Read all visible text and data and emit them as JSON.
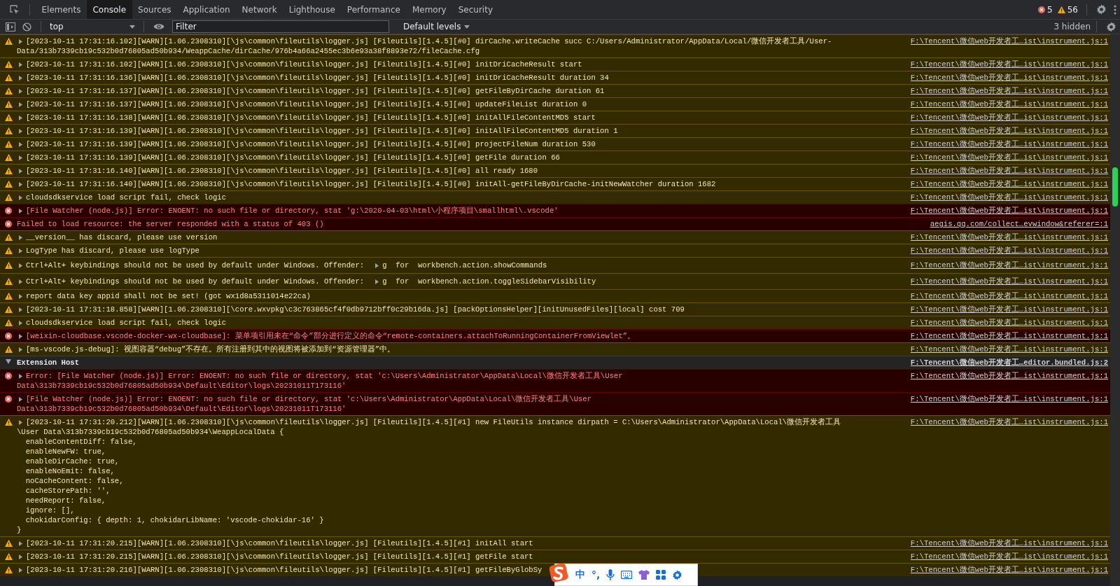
{
  "tabs": [
    {
      "label": "Elements",
      "selected": false
    },
    {
      "label": "Console",
      "selected": true
    },
    {
      "label": "Sources",
      "selected": false
    },
    {
      "label": "Application",
      "selected": false
    },
    {
      "label": "Network",
      "selected": false
    },
    {
      "label": "Lighthouse",
      "selected": false
    },
    {
      "label": "Performance",
      "selected": false
    },
    {
      "label": "Memory",
      "selected": false
    },
    {
      "label": "Security",
      "selected": false
    }
  ],
  "counts": {
    "errors": "5",
    "warnings": "56"
  },
  "console_toolbar": {
    "context": "top",
    "filter_placeholder": "Filter",
    "levels": "Default levels",
    "hidden": "3 hidden"
  },
  "messages": [
    {
      "kind": "warning",
      "expandable": true,
      "lines": [
        "[2023-10-11 17:31:16.102][WARN][1.06.2308310][\\js\\common\\fileutils\\logger.js] [Fileutils][1.4.5][#0] dirCache.writeCache succ C:/Users/Administrator/AppData/Local/微信开发者工具/User-",
        "Data/313b7339cb19c532b0d76805ad50b934/WeappCache/dirCache/976b4a66a2455ec3b6e93a38f8893e72/fileCache.cfg"
      ],
      "source": "F:\\Tencent\\微信web开发者工…ist\\instrument.js:1"
    },
    {
      "kind": "warning",
      "expandable": true,
      "lines": [
        "[2023-10-11 17:31:16.102][WARN][1.06.2308310][\\js\\common\\fileutils\\logger.js] [Fileutils][1.4.5][#0] initDriCacheResult start"
      ],
      "source": "F:\\Tencent\\微信web开发者工…ist\\instrument.js:1"
    },
    {
      "kind": "warning",
      "expandable": true,
      "lines": [
        "[2023-10-11 17:31:16.136][WARN][1.06.2308310][\\js\\common\\fileutils\\logger.js] [Fileutils][1.4.5][#0] initDriCacheResult duration 34"
      ],
      "source": "F:\\Tencent\\微信web开发者工…ist\\instrument.js:1"
    },
    {
      "kind": "warning",
      "expandable": true,
      "lines": [
        "[2023-10-11 17:31:16.137][WARN][1.06.2308310][\\js\\common\\fileutils\\logger.js] [Fileutils][1.4.5][#0] getFileByDirCache duration 61"
      ],
      "source": "F:\\Tencent\\微信web开发者工…ist\\instrument.js:1"
    },
    {
      "kind": "warning",
      "expandable": true,
      "lines": [
        "[2023-10-11 17:31:16.137][WARN][1.06.2308310][\\js\\common\\fileutils\\logger.js] [Fileutils][1.4.5][#0] updateFileList duration 0"
      ],
      "source": "F:\\Tencent\\微信web开发者工…ist\\instrument.js:1"
    },
    {
      "kind": "warning",
      "expandable": true,
      "lines": [
        "[2023-10-11 17:31:16.138][WARN][1.06.2308310][\\js\\common\\fileutils\\logger.js] [Fileutils][1.4.5][#0] initAllFileContentMD5 start"
      ],
      "source": "F:\\Tencent\\微信web开发者工…ist\\instrument.js:1"
    },
    {
      "kind": "warning",
      "expandable": true,
      "lines": [
        "[2023-10-11 17:31:16.139][WARN][1.06.2308310][\\js\\common\\fileutils\\logger.js] [Fileutils][1.4.5][#0] initAllFileContentMD5 duration 1"
      ],
      "source": "F:\\Tencent\\微信web开发者工…ist\\instrument.js:1"
    },
    {
      "kind": "warning",
      "expandable": true,
      "lines": [
        "[2023-10-11 17:31:16.139][WARN][1.06.2308310][\\js\\common\\fileutils\\logger.js] [Fileutils][1.4.5][#0] projectFileNum duration 530"
      ],
      "source": "F:\\Tencent\\微信web开发者工…ist\\instrument.js:1"
    },
    {
      "kind": "warning",
      "expandable": true,
      "lines": [
        "[2023-10-11 17:31:16.139][WARN][1.06.2308310][\\js\\common\\fileutils\\logger.js] [Fileutils][1.4.5][#0] getFile duration 66"
      ],
      "source": "F:\\Tencent\\微信web开发者工…ist\\instrument.js:1"
    },
    {
      "kind": "warning",
      "expandable": true,
      "lines": [
        "[2023-10-11 17:31:16.140][WARN][1.06.2308310][\\js\\common\\fileutils\\logger.js] [Fileutils][1.4.5][#0] all ready 1680"
      ],
      "source": "F:\\Tencent\\微信web开发者工…ist\\instrument.js:1"
    },
    {
      "kind": "warning",
      "expandable": true,
      "lines": [
        "[2023-10-11 17:31:16.140][WARN][1.06.2308310][\\js\\common\\fileutils\\logger.js] [Fileutils][1.4.5][#0] initAll-getFileByDirCache-initNewWatcher duration 1682"
      ],
      "source": "F:\\Tencent\\微信web开发者工…ist\\instrument.js:1"
    },
    {
      "kind": "warning",
      "expandable": true,
      "lines": [
        "cloudsdkservice load script fail, check logic"
      ],
      "source": "F:\\Tencent\\微信web开发者工…ist\\instrument.js:1"
    },
    {
      "kind": "error",
      "expandable": true,
      "lines": [
        "[File Watcher (node.js)] Error: ENOENT: no such file or directory, stat 'g:\\2020-04-03\\html\\小程序项目\\smallhtml\\.vscode'"
      ],
      "source": "F:\\Tencent\\微信web开发者工…ist\\instrument.js:1"
    },
    {
      "kind": "error",
      "expandable": false,
      "lines": [
        "Failed to load resource: the server responded with a status of 403 ()"
      ],
      "source": "aegis.qq.com/collect…evwindow&referer=:1"
    },
    {
      "kind": "warning",
      "expandable": true,
      "lines": [
        "__version__ has discard, please use version"
      ],
      "source": "F:\\Tencent\\微信web开发者工…ist\\instrument.js:1"
    },
    {
      "kind": "warning",
      "expandable": true,
      "lines": [
        "LogType has discard, please use logType"
      ],
      "source": "F:\\Tencent\\微信web开发者工…ist\\instrument.js:1"
    },
    {
      "kind": "warning",
      "expandable": true,
      "lines": [
        "Ctrl+Alt+ keybindings should not be used by default under Windows. Offender:"
      ],
      "offender": "g  for  workbench.action.showCommands",
      "source": "F:\\Tencent\\微信web开发者工…ist\\instrument.js:1"
    },
    {
      "kind": "warning",
      "expandable": true,
      "lines": [
        "Ctrl+Alt+ keybindings should not be used by default under Windows. Offender:"
      ],
      "offender": "g  for  workbench.action.toggleSidebarVisibility",
      "source": "F:\\Tencent\\微信web开发者工…ist\\instrument.js:1"
    },
    {
      "kind": "warning",
      "expandable": true,
      "lines": [
        "report data key appid shall not be set! (got wx1d8a5311014e22ca)"
      ],
      "source": "F:\\Tencent\\微信web开发者工…ist\\instrument.js:1"
    },
    {
      "kind": "warning",
      "expandable": true,
      "lines": [
        "[2023-10-11 17:31:18.858][WARN][1.06.2308310][\\core.wxvpkg\\c3c763865cf4f0db9712bff0c29b16da.js] [packOptionsHelper][initUnusedFiles][local] cost 709"
      ],
      "source": "F:\\Tencent\\微信web开发者工…ist\\instrument.js:1"
    },
    {
      "kind": "warning",
      "expandable": true,
      "lines": [
        "cloudsdkservice load script fail, check logic"
      ],
      "source": "F:\\Tencent\\微信web开发者工…ist\\instrument.js:1"
    },
    {
      "kind": "error",
      "expandable": true,
      "lines": [
        "[weixin-cloudbase.vscode-docker-wx-cloudbase]: 菜单项引用未在“命令”部分进行定义的命令“remote-containers.attachToRunningContainerFromViewlet”。"
      ],
      "source": "F:\\Tencent\\微信web开发者工…ist\\instrument.js:1"
    },
    {
      "kind": "warning",
      "expandable": true,
      "lines": [
        "[ms-vscode.js-debug]: 视图容器“debug”不存在。所有注册到其中的视图将被添加到“资源管理器”中。"
      ],
      "source": "F:\\Tencent\\微信web开发者工…ist\\instrument.js:1"
    },
    {
      "kind": "group",
      "expanded": true,
      "lines": [
        "Extension Host"
      ],
      "source": "F:\\Tencent\\微信web开发者工…editor.bundled.js:2"
    },
    {
      "kind": "error",
      "expandable": true,
      "lines": [
        "Error: [File Watcher (node.js)] Error: ENOENT: no such file or directory, stat 'c:\\Users\\Administrator\\AppData\\Local\\微信开发者工具\\User",
        "Data\\313b7339cb19c532b0d76805ad50b934\\Default\\Editor\\logs\\20231011T173116'"
      ],
      "source": "F:\\Tencent\\微信web开发者工…ist\\instrument.js:1"
    },
    {
      "kind": "error",
      "expandable": true,
      "lines": [
        "[File Watcher (node.js)] Error: ENOENT: no such file or directory, stat 'c:\\Users\\Administrator\\AppData\\Local\\微信开发者工具\\User",
        "Data\\313b7339cb19c532b0d76805ad50b934\\Default\\Editor\\logs\\20231011T173116'"
      ],
      "source": "F:\\Tencent\\微信web开发者工…ist\\instrument.js:1"
    },
    {
      "kind": "warning",
      "expandable": true,
      "lines": [
        "[2023-10-11 17:31:20.212][WARN][1.06.2308310][\\js\\common\\fileutils\\logger.js] [Fileutils][1.4.5][#1] new FileUtils instance dirpath = C:\\Users\\Administrator\\AppData\\Local\\微信开发者工具",
        "\\User Data\\313b7339cb19c532b0d76805ad50b934\\WeappLocalData {",
        "  enableContentDiff: false,",
        "  enableNewFW: true,",
        "  enableDirCache: true,",
        "  enableNoEmit: false,",
        "  noCacheContent: false,",
        "  cacheStorePath: '',",
        "  needReport: false,",
        "  ignore: [],",
        "  chokidarConfig: { depth: 1, chokidarLibName: 'vscode-chokidar-16' }",
        "}"
      ],
      "source": "F:\\Tencent\\微信web开发者工…ist\\instrument.js:1"
    },
    {
      "kind": "warning",
      "expandable": true,
      "lines": [
        "[2023-10-11 17:31:20.215][WARN][1.06.2308310][\\js\\common\\fileutils\\logger.js] [Fileutils][1.4.5][#1] initAll start"
      ],
      "source": "F:\\Tencent\\微信web开发者工…ist\\instrument.js:1"
    },
    {
      "kind": "warning",
      "expandable": true,
      "lines": [
        "[2023-10-11 17:31:20.215][WARN][1.06.2308310][\\js\\common\\fileutils\\logger.js] [Fileutils][1.4.5][#1] getFile start"
      ],
      "source": "F:\\Tencent\\微信web开发者工…ist\\instrument.js:1"
    },
    {
      "kind": "warning",
      "expandable": true,
      "lines": [
        "[2023-10-11 17:31:20.216][WARN][1.06.2308310][\\js\\common\\fileutils\\logger.js] [Fileutils][1.4.5][#1] getFileByGlobSy"
      ],
      "source": "F:\\Tencent\\微信web开发者工…ist\\instrument.js:1"
    }
  ],
  "ime_bar": {
    "mode": "中",
    "punctuation": "°,"
  }
}
